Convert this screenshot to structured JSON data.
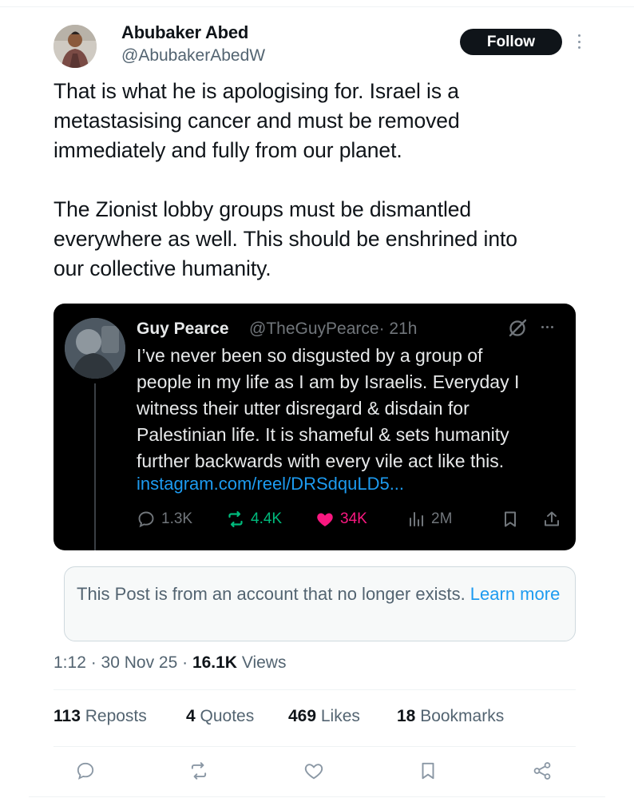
{
  "post": {
    "author_name": "Abubaker Abed",
    "author_handle": "@AbubakerAbedW",
    "follow_label": "Follow",
    "paragraph1": [
      "That is what he is apologising for. Israel is a",
      "metastasising cancer and must be removed",
      "immediately and fully from our planet."
    ],
    "paragraph2": [
      "The Zionist lobby groups must be dismantled",
      "everywhere as well. This should be enshrined into",
      "our collective humanity."
    ]
  },
  "quoted": {
    "author_name": "Guy Pearce",
    "author_handle": "@TheGuyPearce",
    "time": "· 21h",
    "lines": [
      "I’ve never been so disgusted by a group of",
      "people in my life as I am by Israelis. Everyday I",
      "witness their utter disregard & disdain for",
      "Palestinian life. It is shameful & sets humanity",
      "further backwards with every vile act like this."
    ],
    "link": "instagram.com/reel/DRSdquLD5...",
    "replies": "1.3K",
    "reposts": "4.4K",
    "likes": "34K",
    "views": "2M",
    "colors": {
      "repost": "#00ba7c",
      "like": "#f91880",
      "link": "#1d9bf0"
    }
  },
  "notice": {
    "text": "This Post is from an account that no longer exists. ",
    "learn_more": "Learn more"
  },
  "meta": {
    "time": "1:12 · 30 Nov 25 · ",
    "views_count": "16.1K",
    "views_label": " Views"
  },
  "stats": {
    "reposts_count": "113",
    "reposts_label": " Reposts",
    "quotes_count": "4",
    "quotes_label": " Quotes",
    "likes_count": "469",
    "likes_label": " Likes",
    "bookmarks_count": "18",
    "bookmarks_label": " Bookmarks"
  },
  "icons": [
    "reply-icon",
    "repost-icon",
    "like-icon",
    "bookmark-icon",
    "share-icon",
    "views-icon",
    "grok-icon",
    "more-icon"
  ]
}
